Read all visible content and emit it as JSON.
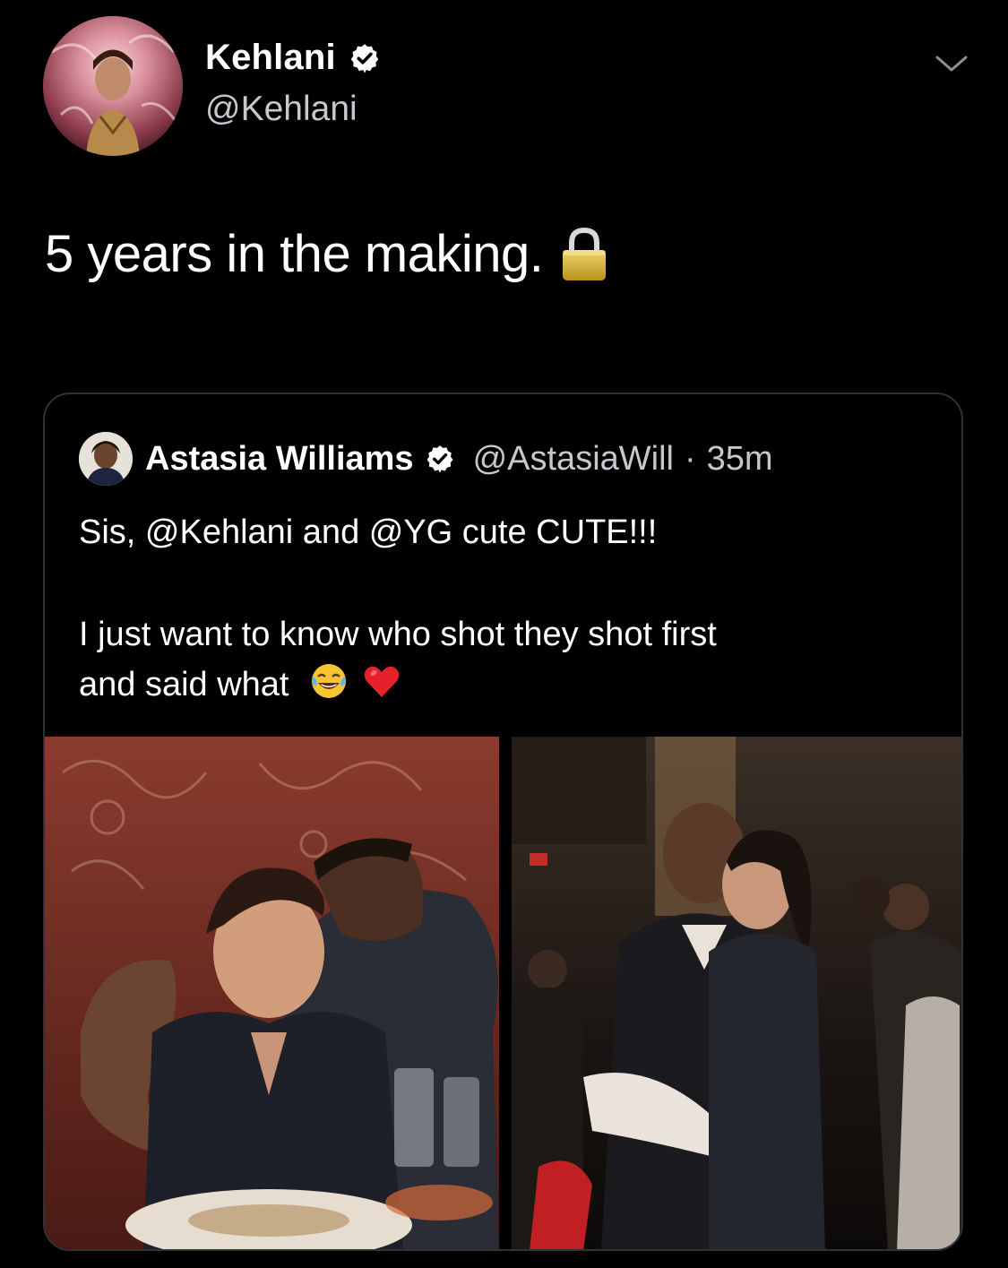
{
  "tweet": {
    "author": {
      "display_name": "Kehlani",
      "handle": "@Kehlani",
      "verified": true
    },
    "text": "5 years in the making.",
    "text_emoji": "lock-icon",
    "menu_icon": "chevron-down-icon"
  },
  "quoted_tweet": {
    "author": {
      "display_name": "Astasia Williams",
      "handle": "@AstasiaWill",
      "verified": true
    },
    "separator": "·",
    "time": "35m",
    "lines": [
      "Sis, @Kehlani and @YG cute CUTE!!!",
      "",
      "I just want to know who shot they shot first",
      "and said what"
    ],
    "trailing_emojis": [
      "tears-of-joy-emoji",
      "red-heart-emoji"
    ],
    "photos": [
      {
        "label": "photo-left"
      },
      {
        "label": "photo-right"
      }
    ]
  },
  "colors": {
    "background": "#000000",
    "primary_text": "#ffffff",
    "secondary_text": "#c7c7cc",
    "card_border": "#2f3336",
    "verified_badge": "#ffffff"
  }
}
